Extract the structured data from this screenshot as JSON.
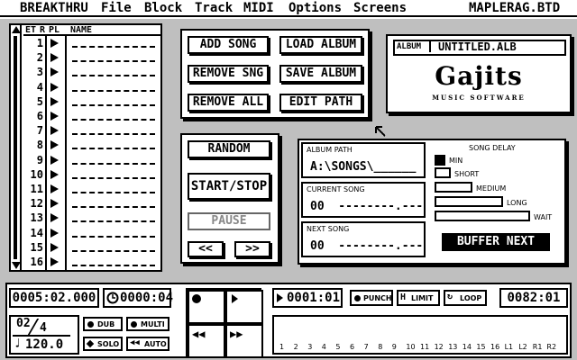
{
  "menubar": {
    "items": [
      "BREAKTHRU",
      "File",
      "Block",
      "Track",
      "MIDI",
      "Options",
      "Screens"
    ],
    "filename": "MAPLERAG.BTD"
  },
  "tracklist": {
    "header": {
      "et": "ET",
      "rp": "R",
      "pl": "PL",
      "name": "NAME"
    },
    "rows": [
      "1",
      "2",
      "3",
      "4",
      "5",
      "6",
      "7",
      "8",
      "9",
      "10",
      "11",
      "12",
      "13",
      "14",
      "15",
      "16"
    ]
  },
  "album_buttons": {
    "add_song": "ADD SONG",
    "load_album": "LOAD ALBUM",
    "remove_sng": "REMOVE SNG",
    "save_album": "SAVE ALBUM",
    "remove_all": "REMOVE ALL",
    "edit_path": "EDIT PATH"
  },
  "album_card": {
    "label": "ALBUM",
    "name": "UNTITLED.ALB",
    "logo": "Gajits",
    "logo_sub": "MUSIC SOFTWARE"
  },
  "play_controls": {
    "random": "RANDOM",
    "start_stop": "START/STOP",
    "pause": "PAUSE",
    "prev": "<<",
    "next": ">>"
  },
  "album_info": {
    "path_label": "ALBUM PATH",
    "path_value": "A:\\SONGS\\______",
    "current_label": "CURRENT SONG",
    "current_value": "00  --------.---",
    "next_label": "NEXT SONG",
    "next_value": "00  --------.---"
  },
  "song_delay": {
    "title": "SONG DELAY",
    "options": [
      "MIN",
      "SHORT",
      "MEDIUM",
      "LONG",
      "WAIT"
    ],
    "selected": "MIN",
    "buffer_next": "BUFFER NEXT"
  },
  "transport": {
    "position": "0005:02.000",
    "time": "0000:04",
    "punch_in": "0001:01",
    "punch": "PUNCH",
    "limit": "LIMIT",
    "loop": "LOOP",
    "punch_out": "0082:01"
  },
  "meter": {
    "time_sig_top": "02",
    "time_sig_bottom": "4",
    "tempo": "120.0",
    "dub": "DUB",
    "multi": "MULTI",
    "solo": "SOLO",
    "auto": "AUTO"
  },
  "channels": [
    "1",
    "2",
    "3",
    "4",
    "5",
    "6",
    "7",
    "8",
    "9",
    "10",
    "11",
    "12",
    "13",
    "14",
    "15",
    "16",
    "L1",
    "L2",
    "R1",
    "R2"
  ]
}
